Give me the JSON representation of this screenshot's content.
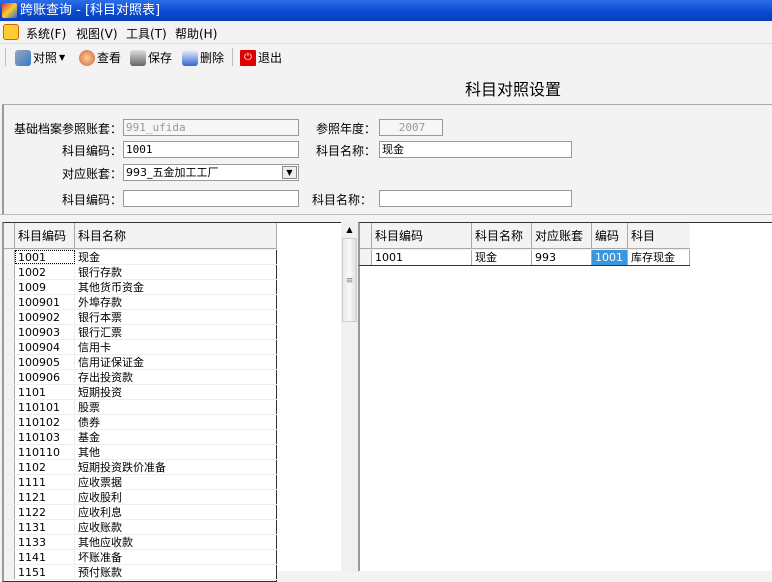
{
  "window": {
    "title": "跨账查询 - [科目对照表]"
  },
  "menu": [
    "系统(F)",
    "视图(V)",
    "工具(T)",
    "帮助(H)"
  ],
  "toolbar": {
    "compare": "对照",
    "view": "查看",
    "save": "保存",
    "delete": "删除",
    "exit": "退出"
  },
  "page_title": "科目对照设置",
  "form": {
    "base_account_label": "基础档案参照账套：",
    "base_account_value": "991_ufida",
    "ref_year_label": "参照年度：",
    "ref_year_value": "2007",
    "code_label": "科目编码：",
    "code_value": "1001",
    "name_label": "科目名称：",
    "name_value": "现金",
    "target_account_label": "对应账套：",
    "target_account_value": "993_五金加工工厂",
    "code2_label": "科目编码：",
    "code2_value": "",
    "name2_label": "科目名称：",
    "name2_value": ""
  },
  "left_grid": {
    "headers": [
      "科目编码",
      "科目名称"
    ],
    "rows": [
      [
        "1001",
        "现金"
      ],
      [
        "1002",
        "银行存款"
      ],
      [
        "1009",
        "其他货币资金"
      ],
      [
        "100901",
        "外埠存款"
      ],
      [
        "100902",
        "银行本票"
      ],
      [
        "100903",
        "银行汇票"
      ],
      [
        "100904",
        "信用卡"
      ],
      [
        "100905",
        "信用证保证金"
      ],
      [
        "100906",
        "存出投资款"
      ],
      [
        "1101",
        "短期投资"
      ],
      [
        "110101",
        "股票"
      ],
      [
        "110102",
        "债券"
      ],
      [
        "110103",
        "基金"
      ],
      [
        "110110",
        "其他"
      ],
      [
        "1102",
        "短期投资跌价准备"
      ],
      [
        "1111",
        "应收票据"
      ],
      [
        "1121",
        "应收股利"
      ],
      [
        "1122",
        "应收利息"
      ],
      [
        "1131",
        "应收账款"
      ],
      [
        "1133",
        "其他应收款"
      ],
      [
        "1141",
        "坏账准备"
      ],
      [
        "1151",
        "预付账款"
      ]
    ]
  },
  "right_grid": {
    "headers": [
      "科目编码",
      "科目名称",
      "对应账套",
      "编码",
      "科目"
    ],
    "rows": [
      [
        "1001",
        "现金",
        "993",
        "1001",
        "库存现金"
      ]
    ]
  },
  "colors": {
    "selection": "#3a96dd",
    "titlebar": "#0a48d0"
  }
}
